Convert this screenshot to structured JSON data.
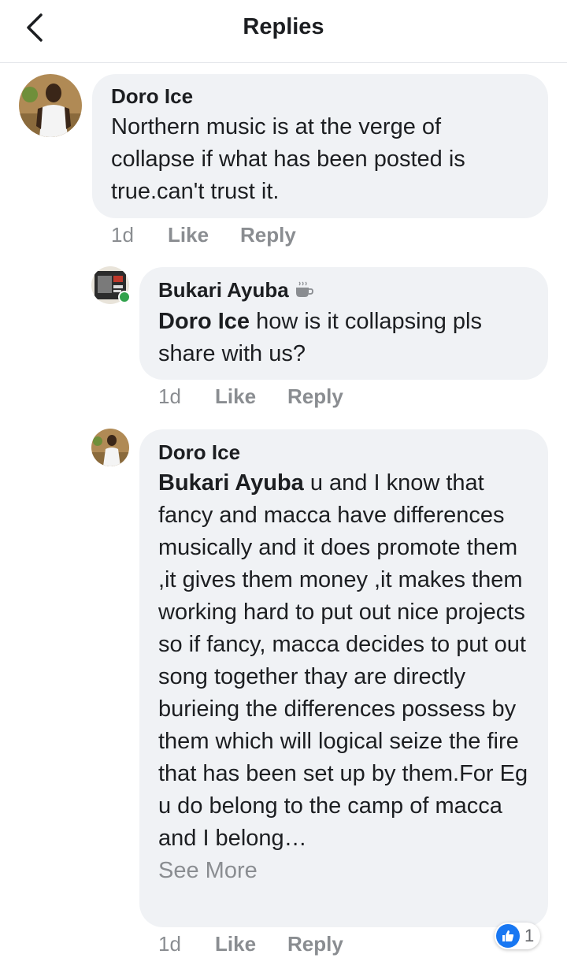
{
  "header": {
    "title": "Replies",
    "back_icon": "chevron-left-icon"
  },
  "colors": {
    "bubble": "#f0f2f5",
    "meta": "#8a8d91",
    "text": "#1c1e21",
    "online": "#31a24c",
    "like_blue": "#1877f2"
  },
  "comments": [
    {
      "author": "Doro Ice",
      "text": "Northern music is at the verge of collapse if what has been posted is true.can't trust it.",
      "time": "1d",
      "like": "Like",
      "reply": "Reply"
    },
    {
      "author": "Bukari Ayuba",
      "author_icon": "coffee-cup-icon",
      "mention": "Doro Ice",
      "text": " how is it collapsing pls share with us?",
      "time": "1d",
      "like": "Like",
      "reply": "Reply"
    },
    {
      "author": "Doro Ice",
      "mention": "Bukari Ayuba",
      "text": " u and I know that fancy and macca have differences musically and it does promote them ,it gives them money ,it makes them working hard to put out nice projects so if fancy, macca decides to put out song together thay are directly burieing the differences possess by them which will logical seize the fire that has been set up by them.For Eg u do belong to the camp of macca and I belong…",
      "see_more": "See More",
      "time": "1d",
      "like": "Like",
      "reply": "Reply",
      "reaction_count": "1"
    }
  ]
}
